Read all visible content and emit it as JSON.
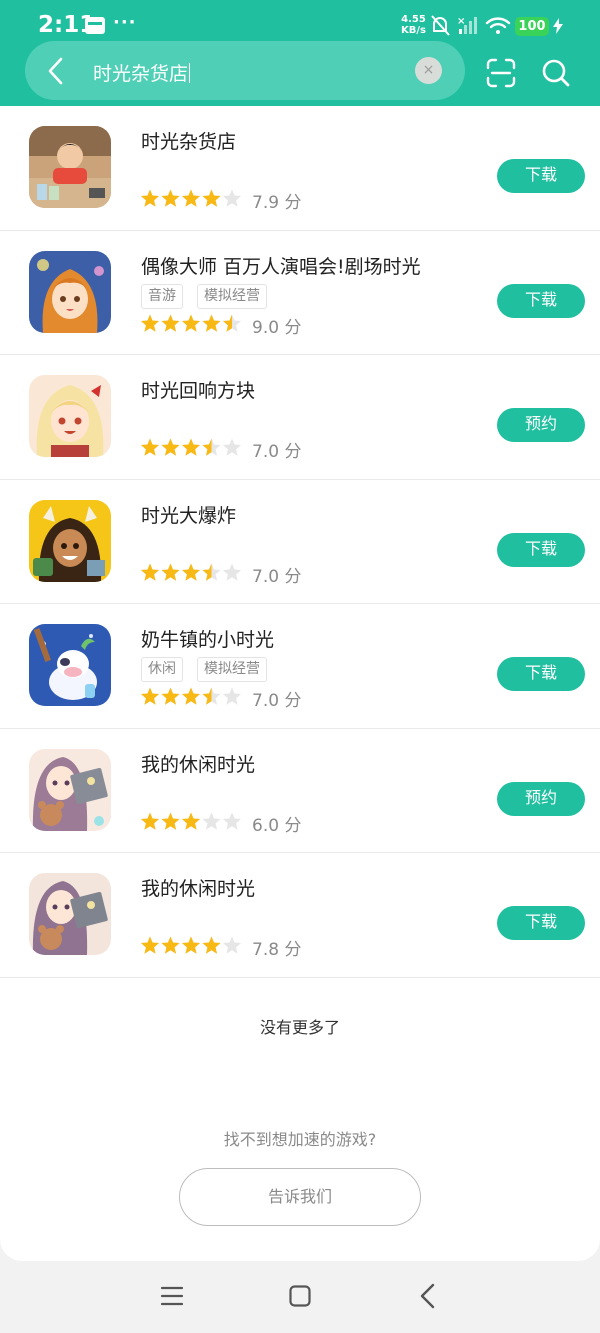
{
  "status_bar": {
    "time": "2:11",
    "dots": "···",
    "net_speed_value": "4.55",
    "net_speed_unit": "KB/s",
    "battery": "100"
  },
  "search": {
    "query": "时光杂货店",
    "clear_glyph": "×"
  },
  "games": [
    {
      "name": "时光杂货店",
      "tags": [],
      "stars": 4,
      "score": "7.9 分",
      "action": "下载",
      "icon": "shop-boy-icon"
    },
    {
      "name": "偶像大师 百万人演唱会!剧场时光",
      "tags": [
        "音游",
        "模拟经营"
      ],
      "stars": 4.5,
      "score": "9.0 分",
      "action": "下载",
      "icon": "idol-girl-icon"
    },
    {
      "name": "时光回响方块",
      "tags": [],
      "stars": 3.5,
      "score": "7.0 分",
      "action": "预约",
      "icon": "blonde-girl-icon"
    },
    {
      "name": "时光大爆炸",
      "tags": [],
      "stars": 3.5,
      "score": "7.0 分",
      "action": "下载",
      "icon": "caveman-icon"
    },
    {
      "name": "奶牛镇的小时光",
      "tags": [
        "休闲",
        "模拟经营"
      ],
      "stars": 3.5,
      "score": "7.0 分",
      "action": "下载",
      "icon": "cow-icon"
    },
    {
      "name": "我的休闲时光",
      "tags": [],
      "stars": 3,
      "score": "6.0 分",
      "action": "预约",
      "icon": "girl-bear-icon"
    },
    {
      "name": "我的休闲时光",
      "tags": [],
      "stars": 4,
      "score": "7.8 分",
      "action": "下载",
      "icon": "girl-bear-icon"
    }
  ],
  "footer": {
    "no_more": "没有更多了",
    "cant_find": "找不到想加速的游戏?",
    "tell_us": "告诉我们"
  },
  "colors": {
    "accent": "#20bfa0",
    "star_filled": "#f9b915",
    "star_empty": "#e6e6e6"
  }
}
